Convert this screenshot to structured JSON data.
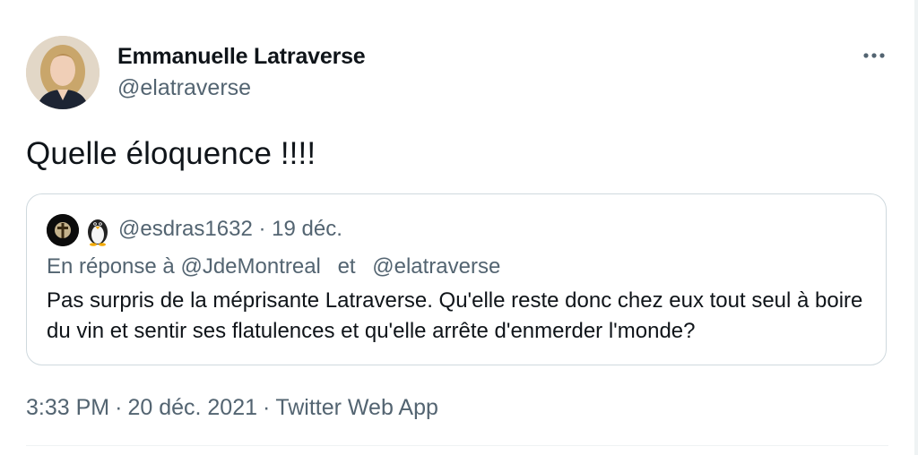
{
  "tweet": {
    "author": {
      "name": "Emmanuelle Latraverse",
      "handle": "@elatraverse"
    },
    "more_icon": "more-horizontal-icon",
    "text": "Quelle éloquence !!!!",
    "quoted": {
      "handle": "@esdras1632",
      "separator": "·",
      "date": "19 déc.",
      "reply_prefix": "En réponse à",
      "reply_to_1": "@JdeMontreal",
      "reply_and": "et",
      "reply_to_2": "@elatraverse",
      "text": "Pas surpris de la méprisante Latraverse. Qu'elle reste donc chez eux tout seul à boire du vin et sentir ses flatulences et qu'elle arrête d'enmerder l'monde?"
    },
    "meta": {
      "time": "3:33 PM",
      "date": "20 déc. 2021",
      "source": "Twitter Web App",
      "separator": "·"
    }
  }
}
